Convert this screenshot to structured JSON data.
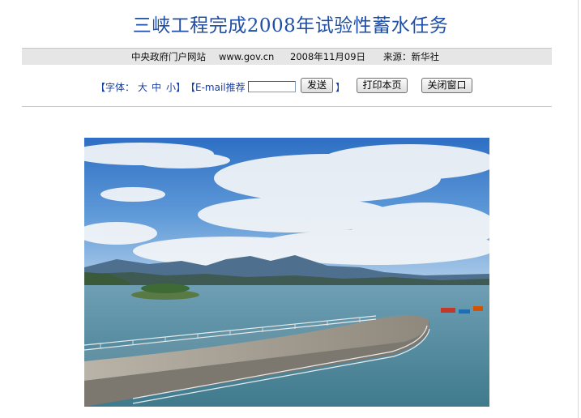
{
  "article": {
    "title": "三峡工程完成2008年试验性蓄水任务"
  },
  "infobar": {
    "site": "中央政府门户网站",
    "url": "www.gov.cn",
    "date": "2008年11月09日",
    "source": "来源：新华社"
  },
  "tools": {
    "font_prefix": "【字体：",
    "font_large": "大",
    "font_medium": "中",
    "font_small": "小",
    "font_suffix": "】",
    "email_label": "【E-mail推荐",
    "email_placeholder": "",
    "send_button": "发送",
    "email_suffix": "】",
    "print_button": "打印本页",
    "close_button": "关闭窗口"
  },
  "colors": {
    "title": "#1f4fa6",
    "link": "#1a3f9c",
    "infobar_bg": "#e6e6e6"
  }
}
